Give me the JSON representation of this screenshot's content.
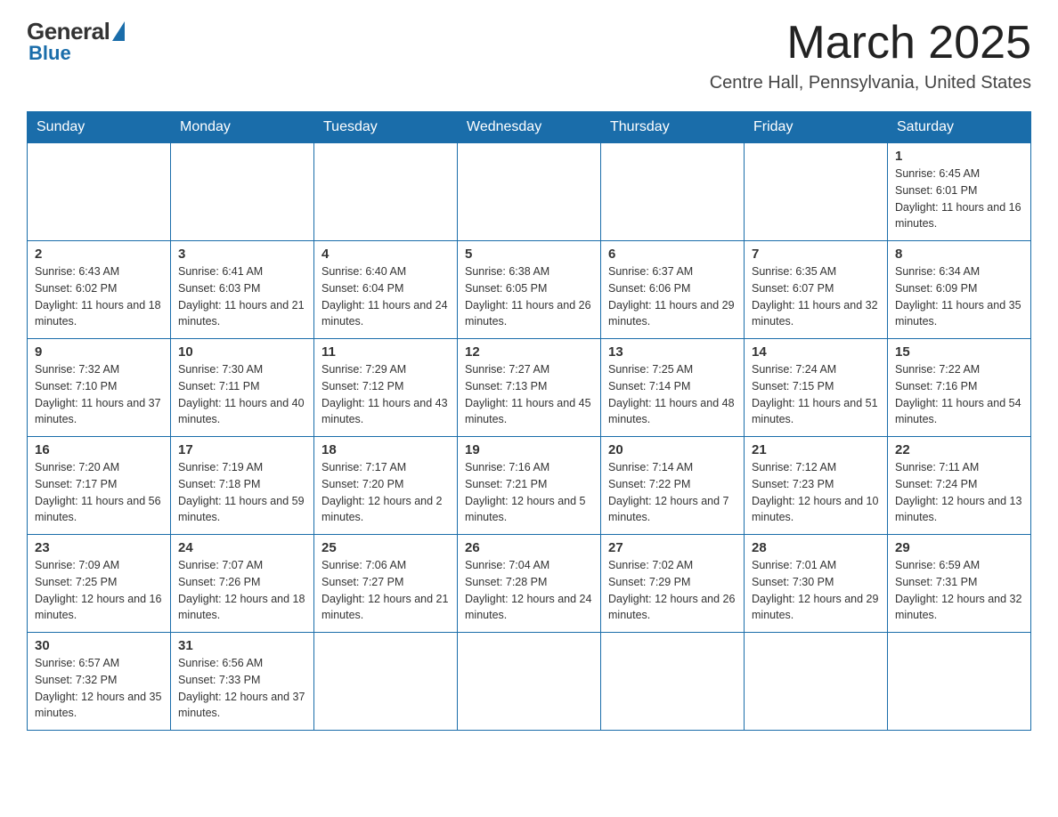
{
  "header": {
    "logo": {
      "general_text": "General",
      "blue_text": "Blue",
      "sub_text": "Blue"
    },
    "title": "March 2025",
    "location": "Centre Hall, Pennsylvania, United States"
  },
  "days_of_week": [
    "Sunday",
    "Monday",
    "Tuesday",
    "Wednesday",
    "Thursday",
    "Friday",
    "Saturday"
  ],
  "weeks": [
    [
      {
        "day": "",
        "info": ""
      },
      {
        "day": "",
        "info": ""
      },
      {
        "day": "",
        "info": ""
      },
      {
        "day": "",
        "info": ""
      },
      {
        "day": "",
        "info": ""
      },
      {
        "day": "",
        "info": ""
      },
      {
        "day": "1",
        "info": "Sunrise: 6:45 AM\nSunset: 6:01 PM\nDaylight: 11 hours and 16 minutes."
      }
    ],
    [
      {
        "day": "2",
        "info": "Sunrise: 6:43 AM\nSunset: 6:02 PM\nDaylight: 11 hours and 18 minutes."
      },
      {
        "day": "3",
        "info": "Sunrise: 6:41 AM\nSunset: 6:03 PM\nDaylight: 11 hours and 21 minutes."
      },
      {
        "day": "4",
        "info": "Sunrise: 6:40 AM\nSunset: 6:04 PM\nDaylight: 11 hours and 24 minutes."
      },
      {
        "day": "5",
        "info": "Sunrise: 6:38 AM\nSunset: 6:05 PM\nDaylight: 11 hours and 26 minutes."
      },
      {
        "day": "6",
        "info": "Sunrise: 6:37 AM\nSunset: 6:06 PM\nDaylight: 11 hours and 29 minutes."
      },
      {
        "day": "7",
        "info": "Sunrise: 6:35 AM\nSunset: 6:07 PM\nDaylight: 11 hours and 32 minutes."
      },
      {
        "day": "8",
        "info": "Sunrise: 6:34 AM\nSunset: 6:09 PM\nDaylight: 11 hours and 35 minutes."
      }
    ],
    [
      {
        "day": "9",
        "info": "Sunrise: 7:32 AM\nSunset: 7:10 PM\nDaylight: 11 hours and 37 minutes."
      },
      {
        "day": "10",
        "info": "Sunrise: 7:30 AM\nSunset: 7:11 PM\nDaylight: 11 hours and 40 minutes."
      },
      {
        "day": "11",
        "info": "Sunrise: 7:29 AM\nSunset: 7:12 PM\nDaylight: 11 hours and 43 minutes."
      },
      {
        "day": "12",
        "info": "Sunrise: 7:27 AM\nSunset: 7:13 PM\nDaylight: 11 hours and 45 minutes."
      },
      {
        "day": "13",
        "info": "Sunrise: 7:25 AM\nSunset: 7:14 PM\nDaylight: 11 hours and 48 minutes."
      },
      {
        "day": "14",
        "info": "Sunrise: 7:24 AM\nSunset: 7:15 PM\nDaylight: 11 hours and 51 minutes."
      },
      {
        "day": "15",
        "info": "Sunrise: 7:22 AM\nSunset: 7:16 PM\nDaylight: 11 hours and 54 minutes."
      }
    ],
    [
      {
        "day": "16",
        "info": "Sunrise: 7:20 AM\nSunset: 7:17 PM\nDaylight: 11 hours and 56 minutes."
      },
      {
        "day": "17",
        "info": "Sunrise: 7:19 AM\nSunset: 7:18 PM\nDaylight: 11 hours and 59 minutes."
      },
      {
        "day": "18",
        "info": "Sunrise: 7:17 AM\nSunset: 7:20 PM\nDaylight: 12 hours and 2 minutes."
      },
      {
        "day": "19",
        "info": "Sunrise: 7:16 AM\nSunset: 7:21 PM\nDaylight: 12 hours and 5 minutes."
      },
      {
        "day": "20",
        "info": "Sunrise: 7:14 AM\nSunset: 7:22 PM\nDaylight: 12 hours and 7 minutes."
      },
      {
        "day": "21",
        "info": "Sunrise: 7:12 AM\nSunset: 7:23 PM\nDaylight: 12 hours and 10 minutes."
      },
      {
        "day": "22",
        "info": "Sunrise: 7:11 AM\nSunset: 7:24 PM\nDaylight: 12 hours and 13 minutes."
      }
    ],
    [
      {
        "day": "23",
        "info": "Sunrise: 7:09 AM\nSunset: 7:25 PM\nDaylight: 12 hours and 16 minutes."
      },
      {
        "day": "24",
        "info": "Sunrise: 7:07 AM\nSunset: 7:26 PM\nDaylight: 12 hours and 18 minutes."
      },
      {
        "day": "25",
        "info": "Sunrise: 7:06 AM\nSunset: 7:27 PM\nDaylight: 12 hours and 21 minutes."
      },
      {
        "day": "26",
        "info": "Sunrise: 7:04 AM\nSunset: 7:28 PM\nDaylight: 12 hours and 24 minutes."
      },
      {
        "day": "27",
        "info": "Sunrise: 7:02 AM\nSunset: 7:29 PM\nDaylight: 12 hours and 26 minutes."
      },
      {
        "day": "28",
        "info": "Sunrise: 7:01 AM\nSunset: 7:30 PM\nDaylight: 12 hours and 29 minutes."
      },
      {
        "day": "29",
        "info": "Sunrise: 6:59 AM\nSunset: 7:31 PM\nDaylight: 12 hours and 32 minutes."
      }
    ],
    [
      {
        "day": "30",
        "info": "Sunrise: 6:57 AM\nSunset: 7:32 PM\nDaylight: 12 hours and 35 minutes."
      },
      {
        "day": "31",
        "info": "Sunrise: 6:56 AM\nSunset: 7:33 PM\nDaylight: 12 hours and 37 minutes."
      },
      {
        "day": "",
        "info": ""
      },
      {
        "day": "",
        "info": ""
      },
      {
        "day": "",
        "info": ""
      },
      {
        "day": "",
        "info": ""
      },
      {
        "day": "",
        "info": ""
      }
    ]
  ]
}
